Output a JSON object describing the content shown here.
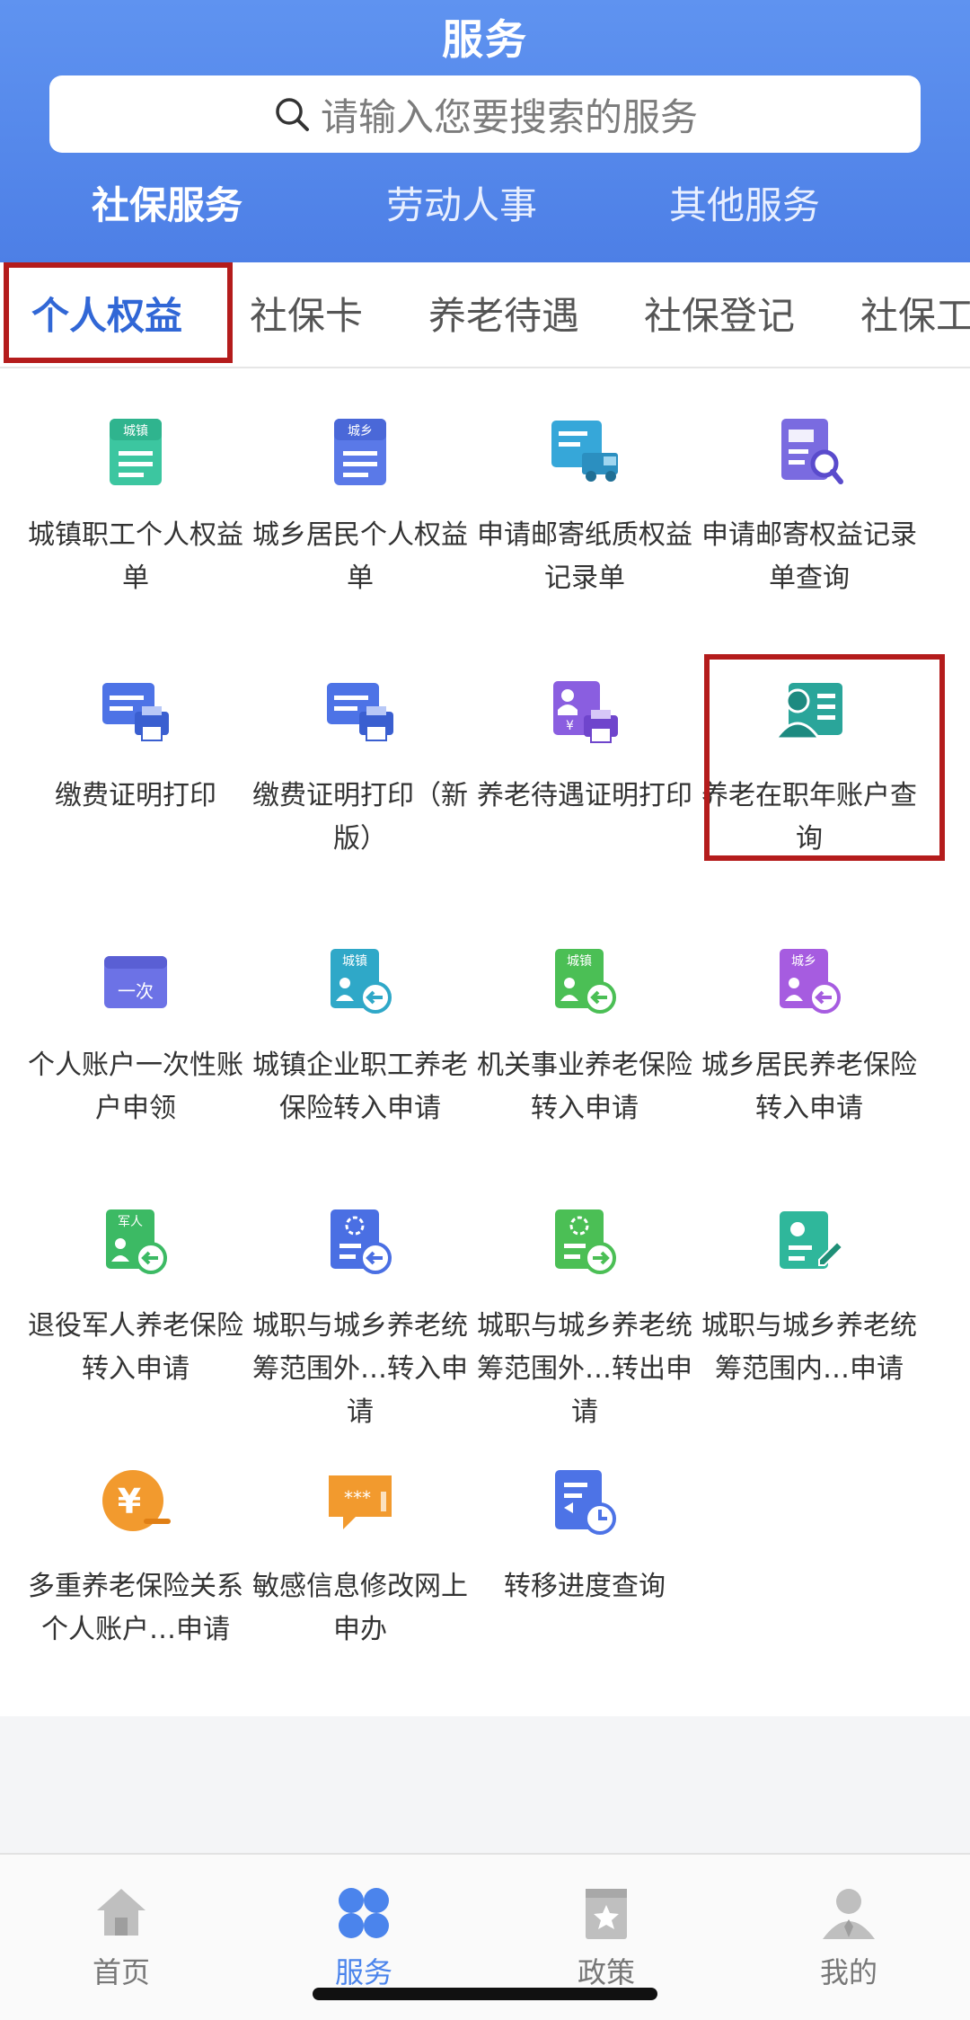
{
  "header": {
    "title": "服务",
    "search_placeholder": "请输入您要搜索的服务",
    "tabs": [
      "社保服务",
      "劳动人事",
      "其他服务"
    ]
  },
  "subtabs": [
    "个人权益",
    "社保卡",
    "养老待遇",
    "社保登记",
    "社保工"
  ],
  "grid": [
    {
      "label": "城镇职工个人权益单",
      "icon": "urban-doc-icon",
      "badge": "城镇"
    },
    {
      "label": "城乡居民个人权益单",
      "icon": "rural-doc-icon",
      "badge": "城乡"
    },
    {
      "label": "申请邮寄纸质权益记录单",
      "icon": "mail-truck-icon"
    },
    {
      "label": "申请邮寄权益记录单查询",
      "icon": "truck-search-icon"
    },
    {
      "label": "缴费证明打印",
      "icon": "printer-card-icon"
    },
    {
      "label": "缴费证明打印（新版）",
      "icon": "printer-card-new-icon"
    },
    {
      "label": "养老待遇证明打印",
      "icon": "pension-print-icon"
    },
    {
      "label": "养老在职年账户查询",
      "icon": "person-account-icon"
    },
    {
      "label": "个人账户一次性账户申领",
      "icon": "one-time-icon",
      "badge": "一次"
    },
    {
      "label": "城镇企业职工养老保险转入申请",
      "icon": "urban-transfer-in-icon",
      "badge": "城镇"
    },
    {
      "label": "机关事业养老保险转入申请",
      "icon": "institution-transfer-in-icon",
      "badge": "城镇"
    },
    {
      "label": "城乡居民养老保险转入申请",
      "icon": "rural-transfer-in-icon",
      "badge": "城乡"
    },
    {
      "label": "退役军人养老保险转入申请",
      "icon": "veteran-transfer-icon",
      "badge": "军人"
    },
    {
      "label": "城职与城乡养老统筹范围外…转入申请",
      "icon": "transfer-in-outside-icon"
    },
    {
      "label": "城职与城乡养老统筹范围外…转出申请",
      "icon": "transfer-out-outside-icon"
    },
    {
      "label": "城职与城乡养老统筹范围内…申请",
      "icon": "edit-apply-icon"
    },
    {
      "label": "多重养老保险关系个人账户…申请",
      "icon": "yuan-coin-icon",
      "badge": "¥"
    },
    {
      "label": "敏感信息修改网上申办",
      "icon": "chat-password-icon",
      "badge": "***"
    },
    {
      "label": "转移进度查询",
      "icon": "progress-clock-icon"
    }
  ],
  "nav": [
    {
      "label": "首页",
      "icon": "home-icon"
    },
    {
      "label": "服务",
      "icon": "service-icon"
    },
    {
      "label": "政策",
      "icon": "policy-icon"
    },
    {
      "label": "我的",
      "icon": "profile-icon"
    }
  ],
  "colors": {
    "header": "#5a8ef0",
    "accent": "#3167d6",
    "highlight_box": "#b41c1c"
  }
}
